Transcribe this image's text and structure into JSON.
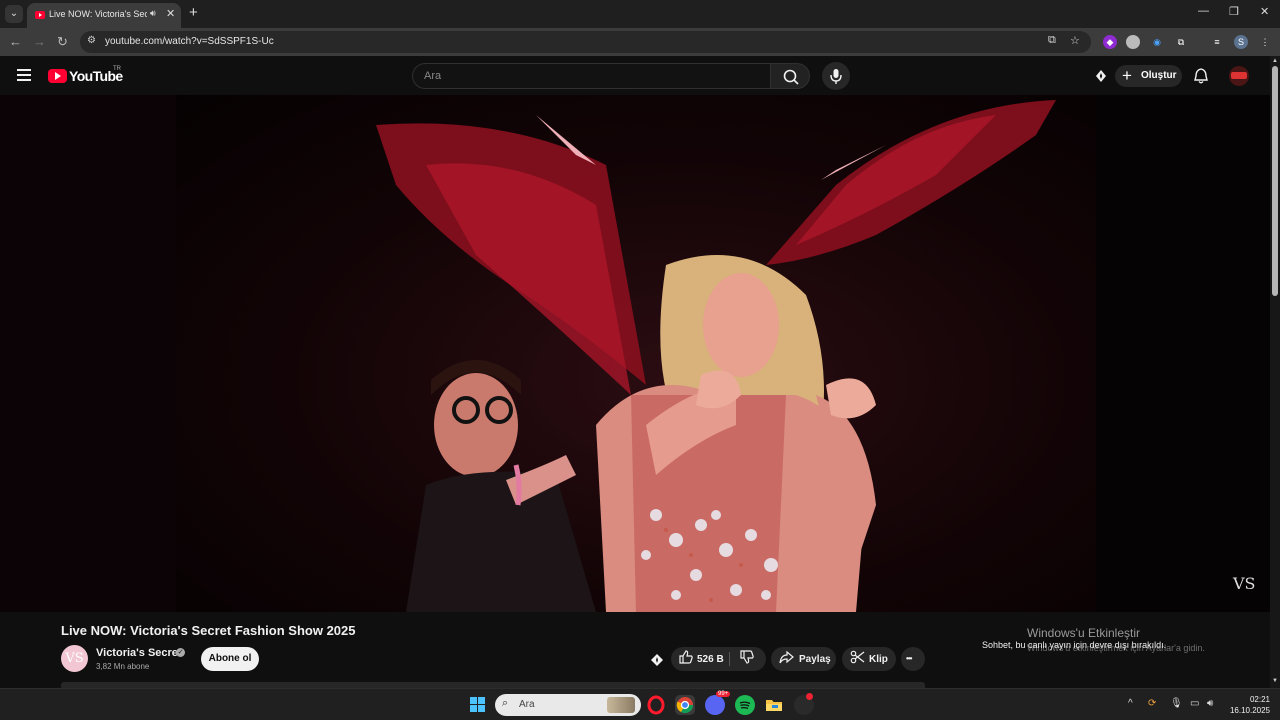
{
  "browser": {
    "tab_title": "Live NOW: Victoria's Secret Fashion Show 2025",
    "url": "youtube.com/watch?v=SdSSPF1S-Uc",
    "window_controls": [
      "minimize-icon",
      "restore-icon",
      "close-icon"
    ]
  },
  "youtube": {
    "logo_text": "YouTube",
    "country_code": "TR",
    "search_placeholder": "Ara",
    "create_label": "Oluştur"
  },
  "video": {
    "title": "Live NOW: Victoria's Secret Fashion Show 2025",
    "watermark": "VS"
  },
  "channel": {
    "avatar_initials": "VS",
    "name": "Victoria's Secret",
    "subscribers": "3,82 Mn abone",
    "subscribe_label": "Abone ol"
  },
  "actions": {
    "likes": "526 B",
    "share_label": "Paylaş",
    "clip_label": "Klip",
    "more_label": "•••"
  },
  "overlay": {
    "activation_title": "Windows'u Etkinleştir",
    "activation_subtitle": "Windows'u etkinleştirmek için Ayarlar'a gidin.",
    "chat_disabled": "Sohbet, bu canlı yayın için devre dışı bırakıldı."
  },
  "taskbar": {
    "search_placeholder": "Ara",
    "time": "02:21",
    "date": "16.10.2025",
    "discord_badge": "99+"
  },
  "colors": {
    "youtube_red": "#ff0033",
    "page_bg": "#0f0f0f",
    "pill_bg": "#272727"
  }
}
